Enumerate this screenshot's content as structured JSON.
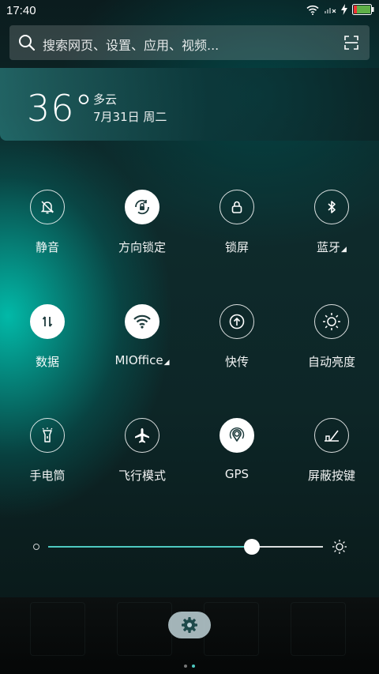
{
  "status_bar": {
    "time": "17:40"
  },
  "search": {
    "placeholder": "搜索网页、设置、应用、视频..."
  },
  "weather": {
    "temperature": "36°",
    "condition": "多云",
    "date": "7月31日 周二"
  },
  "toggles": [
    {
      "label": "静音",
      "icon": "mute-bell-icon",
      "on": false,
      "has_arrow": false
    },
    {
      "label": "方向锁定",
      "icon": "rotation-lock-icon",
      "on": true,
      "has_arrow": false
    },
    {
      "label": "锁屏",
      "icon": "lock-icon",
      "on": false,
      "has_arrow": false
    },
    {
      "label": "蓝牙",
      "icon": "bluetooth-icon",
      "on": false,
      "has_arrow": true
    },
    {
      "label": "数据",
      "icon": "mobile-data-icon",
      "on": true,
      "has_arrow": false
    },
    {
      "label": "MIOffice",
      "icon": "wifi-icon",
      "on": true,
      "has_arrow": true
    },
    {
      "label": "快传",
      "icon": "quick-transfer-icon",
      "on": false,
      "has_arrow": false
    },
    {
      "label": "自动亮度",
      "icon": "auto-brightness-icon",
      "on": false,
      "has_arrow": false
    },
    {
      "label": "手电筒",
      "icon": "flashlight-icon",
      "on": false,
      "has_arrow": false
    },
    {
      "label": "飞行模式",
      "icon": "airplane-icon",
      "on": false,
      "has_arrow": false
    },
    {
      "label": "GPS",
      "icon": "gps-icon",
      "on": true,
      "has_arrow": false
    },
    {
      "label": "屏蔽按键",
      "icon": "block-keys-icon",
      "on": false,
      "has_arrow": false
    }
  ],
  "brightness": {
    "level": 0.74,
    "accent_color": "#4ec9c0"
  },
  "pager": {
    "current": 2,
    "total": 2
  }
}
